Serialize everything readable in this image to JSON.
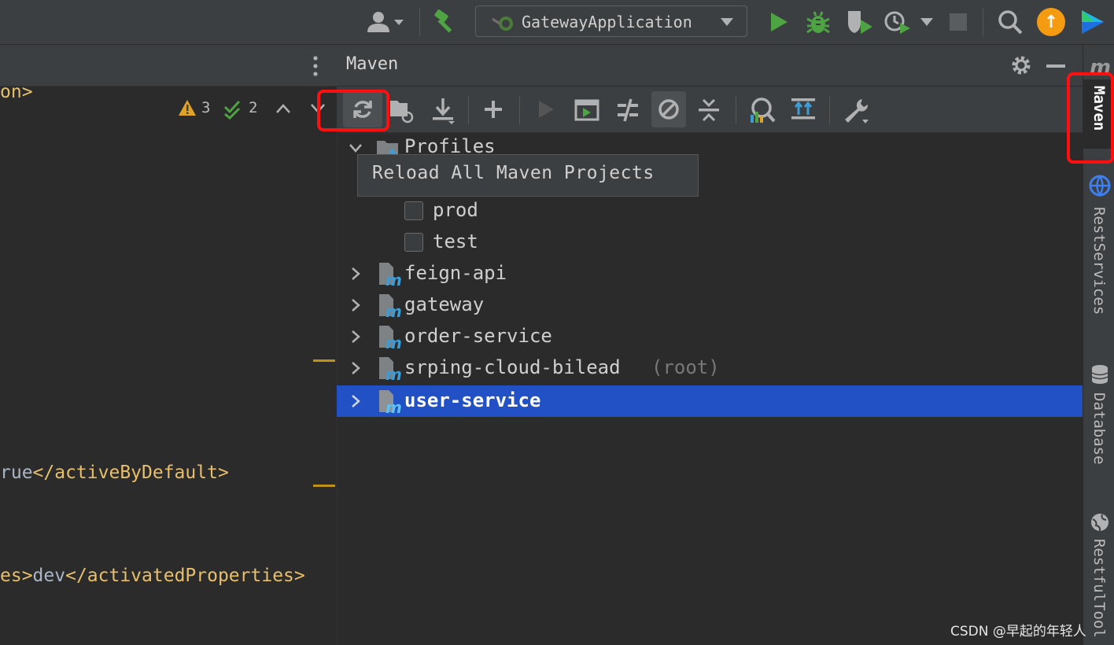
{
  "toolbar": {
    "run_config_label": "GatewayApplication",
    "update_badge": "↑"
  },
  "editor": {
    "warnings_count": "3",
    "weak_warnings_count": "2",
    "lines": [
      {
        "tag_start": "on>",
        "value": "",
        "tag_end": ""
      },
      {
        "tag_start": "",
        "value": "rue",
        "tag_end": "</activeByDefault>"
      },
      {
        "tag_start": "es>",
        "value": "dev",
        "tag_end": "</activatedProperties>"
      }
    ]
  },
  "maven": {
    "title": "Maven",
    "tooltip": "Reload All Maven Projects",
    "tree": {
      "profiles_label": "Profiles",
      "profiles": [
        {
          "name": "prod",
          "checked": false
        },
        {
          "name": "test",
          "checked": false
        }
      ],
      "projects": [
        {
          "name": "feign-api",
          "suffix": ""
        },
        {
          "name": "gateway",
          "suffix": ""
        },
        {
          "name": "order-service",
          "suffix": ""
        },
        {
          "name": "srping-cloud-bilead",
          "suffix": "(root)"
        },
        {
          "name": "user-service",
          "suffix": "",
          "selected": true
        }
      ]
    }
  },
  "right_stripe": {
    "m_label": "m",
    "tabs": [
      "Maven",
      "RestServices",
      "Database",
      "RestfulTool"
    ]
  },
  "watermark": "CSDN @早起的年轻人",
  "colors": {
    "accent_selection": "#2251c5",
    "highlight_red": "#ff1010",
    "run_green": "#4ea343",
    "tag_yellow": "#e8bf6a"
  }
}
